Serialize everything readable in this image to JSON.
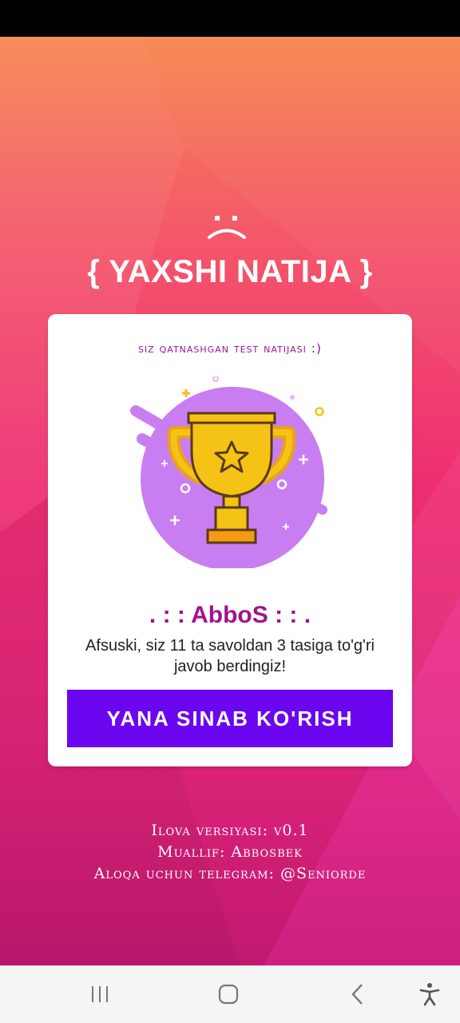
{
  "header": {
    "title": "{ YAXSHI NATIJA }"
  },
  "card": {
    "subtitle": "siz qatnashgan test natijasi :)",
    "user_name": ". : : AbboS : : .",
    "result_text": "Afsuski, siz 11 ta savoldan 3 tasiga to'g'ri javob berdingiz!",
    "retry_label": "YANA SINAB KO'RISH"
  },
  "footer": {
    "version": "Ilova versiyasi: v0.1",
    "author": "Muallif: Abbosbek",
    "contact": "Aloqa uchun telegram: @Seniorde"
  },
  "nav": {
    "icons": [
      "recent-apps-icon",
      "home-icon",
      "back-icon",
      "accessibility-icon"
    ]
  },
  "colors": {
    "accent": "#6a06f0",
    "name": "#a3128c",
    "subtitle": "#9c1493",
    "trophy_circle": "#c87ef0",
    "trophy_gold": "#f5c316"
  }
}
